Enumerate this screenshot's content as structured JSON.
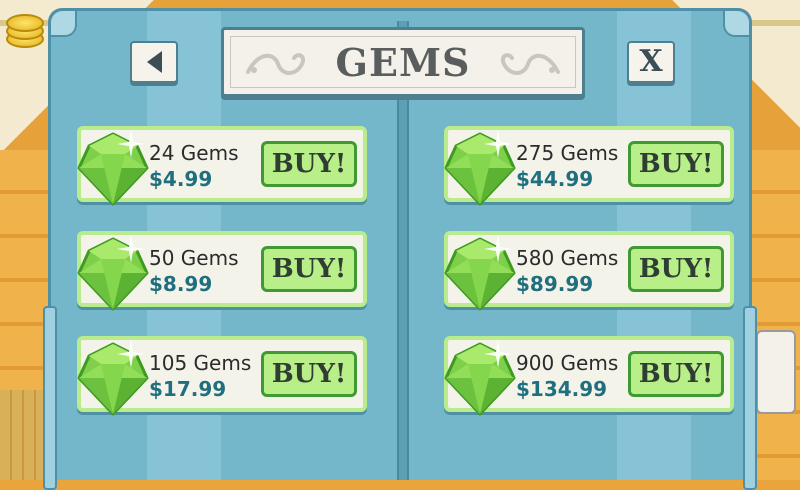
{
  "header": {
    "title": "GEMS",
    "close_label": "X"
  },
  "icons": {
    "back": "back-arrow-icon",
    "close": "close-icon",
    "gem": "green-gem-icon",
    "coins": "coin-stack-icon"
  },
  "colors": {
    "panel": "#74b7cb",
    "card": "#f4f3ea",
    "card_border": "#b9ec8c",
    "buy_button": "#b8ef88",
    "price_text": "#1f6f7f"
  },
  "offers": [
    {
      "amount": "24 Gems",
      "price": "$4.99",
      "buy_label": "BUY!"
    },
    {
      "amount": "275 Gems",
      "price": "$44.99",
      "buy_label": "BUY!"
    },
    {
      "amount": "50 Gems",
      "price": "$8.99",
      "buy_label": "BUY!"
    },
    {
      "amount": "580 Gems",
      "price": "$89.99",
      "buy_label": "BUY!"
    },
    {
      "amount": "105 Gems",
      "price": "$17.99",
      "buy_label": "BUY!"
    },
    {
      "amount": "900 Gems",
      "price": "$134.99",
      "buy_label": "BUY!"
    }
  ]
}
